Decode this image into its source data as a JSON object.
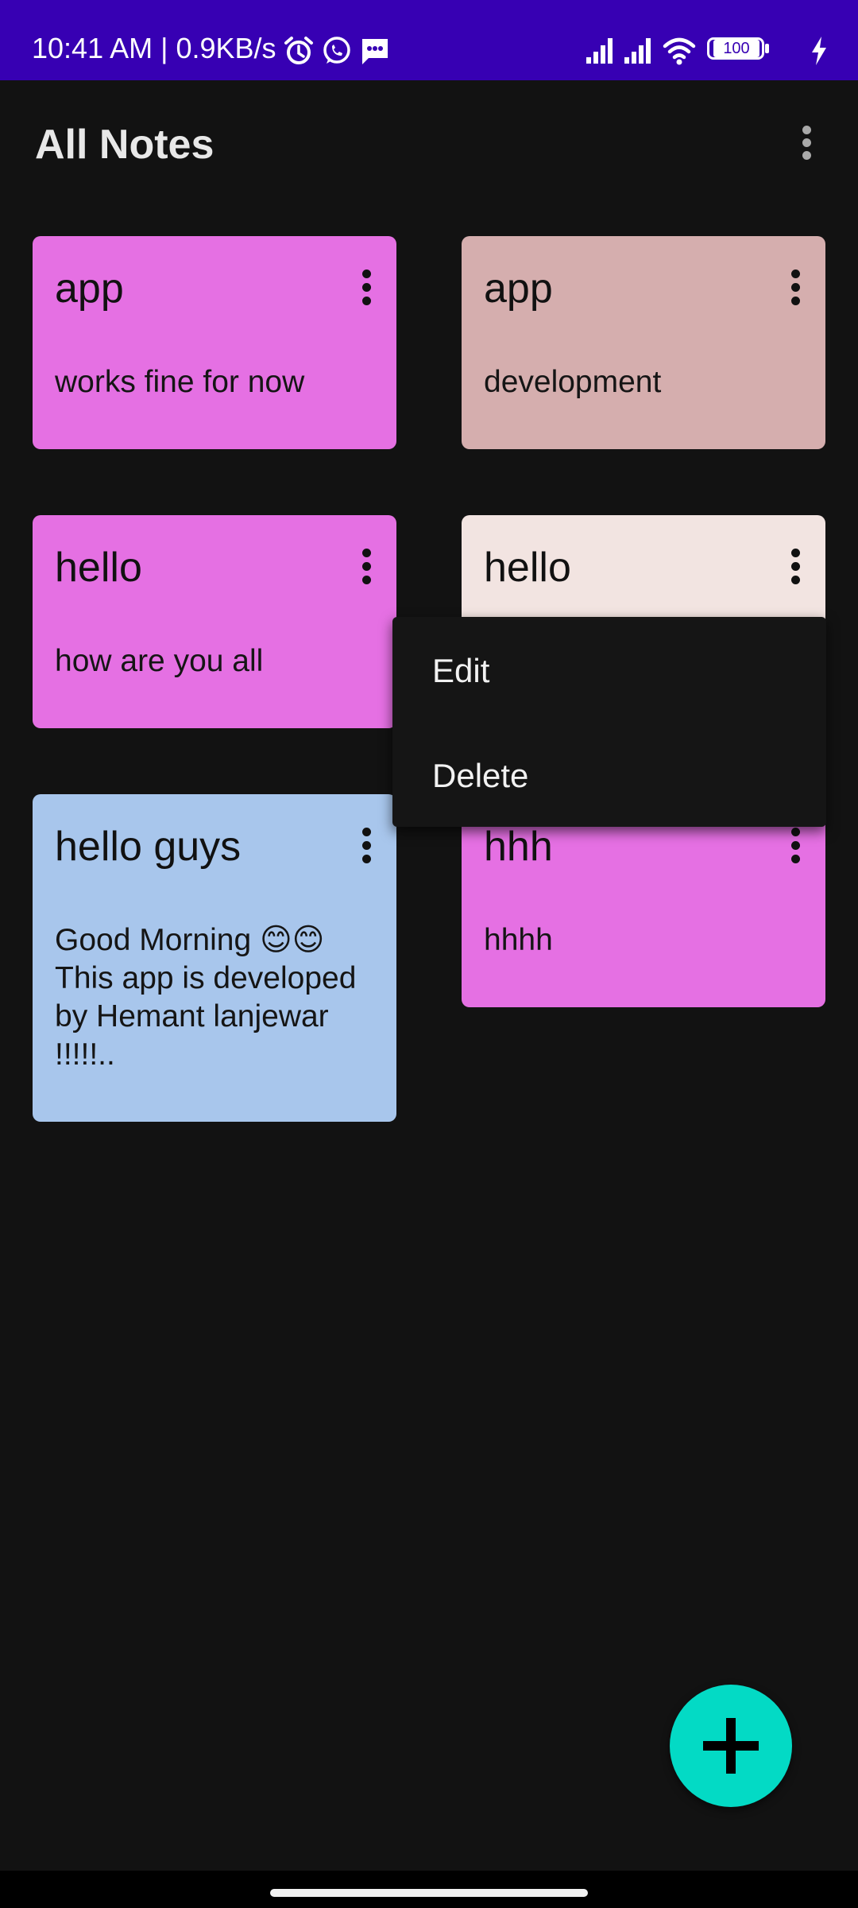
{
  "status_bar": {
    "time_speed": "10:41 AM | 0.9KB/s",
    "battery": "100",
    "icons": [
      "alarm-icon",
      "whatsapp-icon",
      "message-icon",
      "signal-icon",
      "signal-icon",
      "wifi-icon",
      "battery-icon",
      "charging-icon"
    ]
  },
  "app_bar": {
    "title": "All Notes",
    "menu_icon": "more-vert-icon"
  },
  "notes": [
    {
      "title": "app",
      "body": "works fine for now",
      "color": "#e570e3"
    },
    {
      "title": "app",
      "body": "development",
      "color": "#d5aeae"
    },
    {
      "title": "hello",
      "body": "how are you all",
      "color": "#e570e3"
    },
    {
      "title": "hello",
      "body": "",
      "color": "#f2e4e1"
    },
    {
      "title": "hello guys",
      "body": "Good Morning 😊😊 This app is developed by Hemant lanjewar !!!!!..",
      "color": "#a8c6ec"
    },
    {
      "title": "hhh",
      "body": "hhhh",
      "color": "#e570e3"
    }
  ],
  "popup_menu": {
    "items": [
      "Edit",
      "Delete"
    ]
  },
  "fab": {
    "icon": "plus-icon",
    "color": "#03dac5"
  },
  "colors": {
    "status_bar": "#3700b3",
    "background": "#121212"
  }
}
